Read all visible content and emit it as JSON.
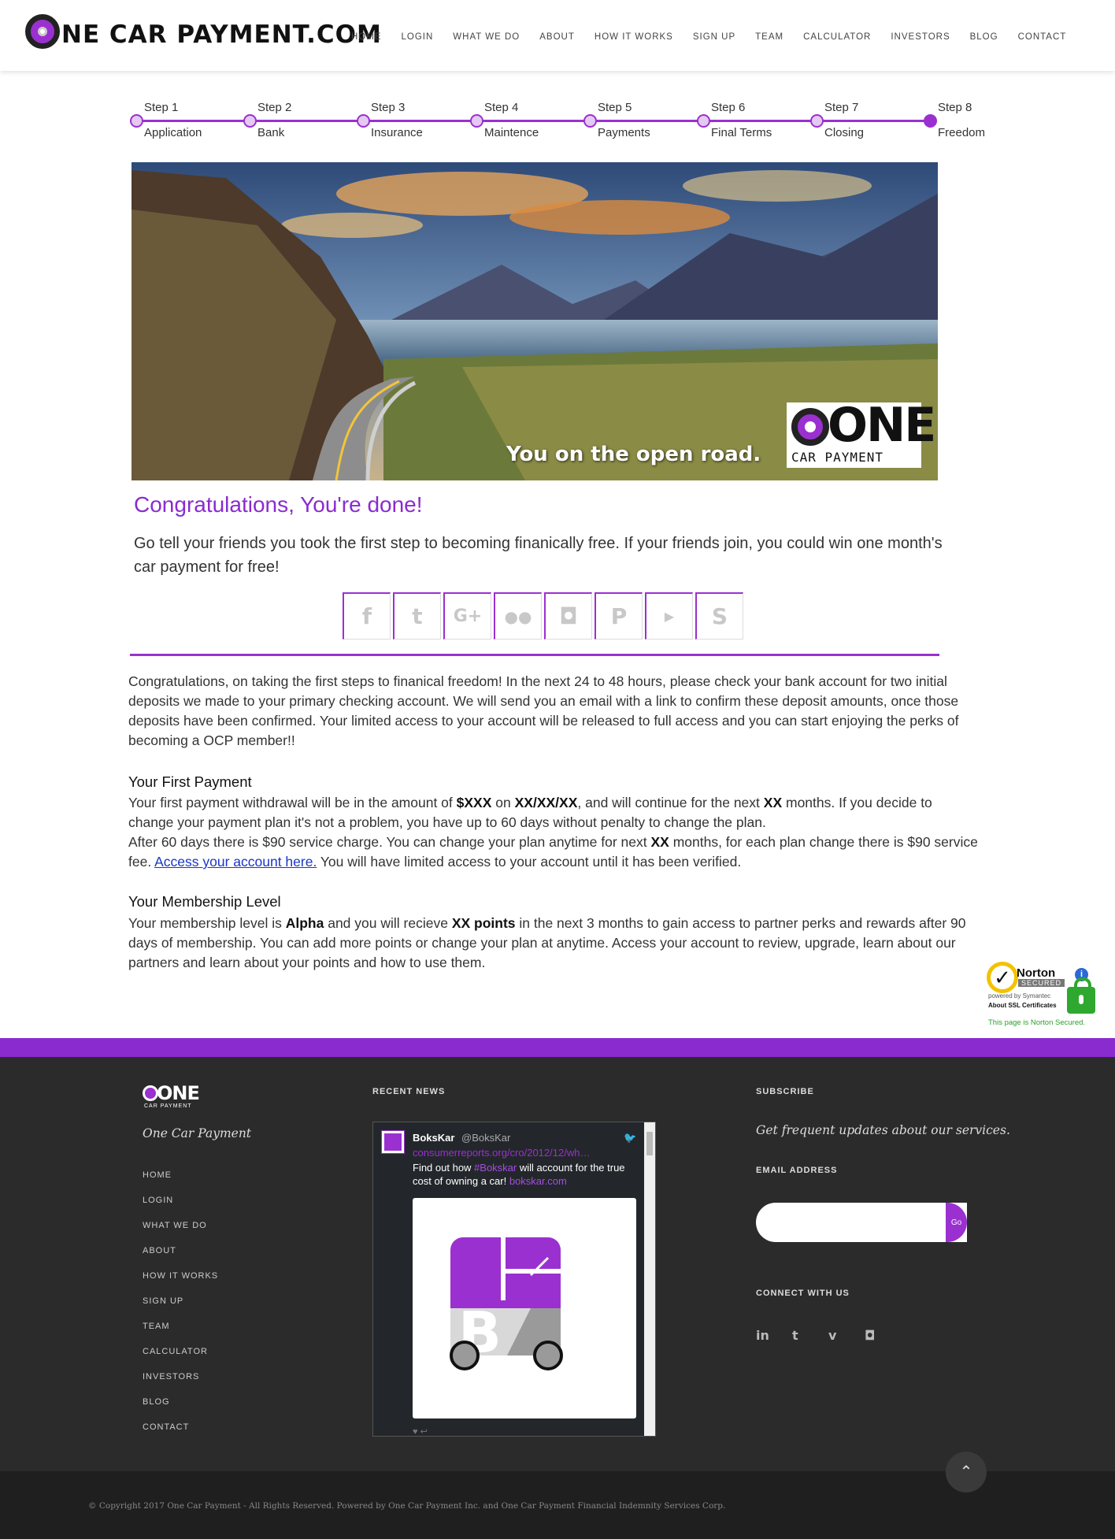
{
  "header": {
    "logo_text": "NE CAR PAYMENT.COM",
    "nav": [
      "HOME",
      "LOGIN",
      "WHAT WE DO",
      "ABOUT",
      "HOW IT WORKS",
      "SIGN UP",
      "TEAM",
      "CALCULATOR",
      "INVESTORS",
      "BLOG",
      "CONTACT"
    ]
  },
  "stepper": {
    "steps": [
      {
        "num": "Step 1",
        "name": "Application"
      },
      {
        "num": "Step 2",
        "name": "Bank"
      },
      {
        "num": "Step 3",
        "name": "Insurance"
      },
      {
        "num": "Step 4",
        "name": "Maintence"
      },
      {
        "num": "Step 5",
        "name": "Payments"
      },
      {
        "num": "Step 6",
        "name": "Final Terms"
      },
      {
        "num": "Step 7",
        "name": "Closing"
      },
      {
        "num": "Step 8",
        "name": "Freedom"
      }
    ],
    "active_step": 8
  },
  "hero": {
    "caption": "You on the open road.",
    "logo_one": "ONE",
    "logo_sub": "CAR PAYMENT"
  },
  "congrats": {
    "title": "Congratulations, You're done!",
    "subtitle": "Go tell your friends you took the first step to becoming finanically free.  If your friends join, you could win one month's car payment for free!"
  },
  "social": [
    "facebook-icon",
    "twitter-icon",
    "google-plus-icon",
    "flickr-icon",
    "instagram-icon",
    "pinterest-icon",
    "youtube-icon",
    "skype-icon"
  ],
  "intro": "Congratulations, on taking the first steps to finanical freedom!  In the next 24 to 48 hours, please check your bank account for two initial deposits we made to your primary checking account.  We will send you an email with a link to confirm these deposit amounts, once those deposits have been confirmed.  Your limited access to your account will be released to full access and you can start enjoying the perks of becoming a OCP member!!",
  "first_payment": {
    "heading": "Your First Payment",
    "p1_a": "Your first payment withdrawal will be in the amount of ",
    "amount": "$XXX",
    "p1_b": " on ",
    "date": "XX/XX/XX",
    "p1_c": ", and will continue for the next ",
    "months": "XX",
    "p1_d": " months.  If you decide to change your payment plan it's not a problem, you have up to 60 days without penalty to change the plan.",
    "p2_a": "After 60 days there is $90 service charge.  You can change your plan anytime for next ",
    "months2": "XX",
    "p2_b": " months, for each plan change there is $90 service fee.  ",
    "link": "Access your account here.",
    "p2_c": "  You will have limited access to your account until it has been verified."
  },
  "membership": {
    "heading": "Your Membership Level",
    "a": "Your membership level is ",
    "level": "Alpha",
    "b": " and you will recieve ",
    "points": "XX points",
    "c": " in the next 3 months to gain access to partner perks and rewards after 90 days of membership.  You can add more points or change your plan at anytime.  Access your account to review, upgrade, learn about our partners and learn about your points and how to use them."
  },
  "norton": {
    "name": "Norton",
    "secured": "SECURED",
    "powered": "powered by Symantec",
    "ssl": "About SSL Certificates",
    "foot": "This page is Norton Secured."
  },
  "footer": {
    "logo_one": "ONE",
    "logo_sub": "CAR PAYMENT",
    "brand": "One Car Payment",
    "nav": [
      "HOME",
      "LOGIN",
      "WHAT WE DO",
      "ABOUT",
      "HOW IT WORKS",
      "SIGN UP",
      "TEAM",
      "CALCULATOR",
      "INVESTORS",
      "BLOG",
      "CONTACT"
    ],
    "recent_news": "RECENT NEWS",
    "subscribe": "SUBSCRIBE",
    "subscribe_tag": "Get frequent updates about our services.",
    "email_label": "EMAIL ADDRESS",
    "email_placeholder": "",
    "go": "Go",
    "connect": "CONNECT WITH US",
    "connect_icons": [
      "linkedin-icon",
      "twitter-icon",
      "vimeo-icon",
      "instagram-icon"
    ],
    "copyright": "© Copyright 2017 One Car Payment - All Rights Reserved. Powered by One Car Payment Inc. and One Car Payment Financial Indemnity Services Corp."
  },
  "tweet": {
    "name": "BoksKar",
    "handle": "@BoksKar",
    "link": "consumerreports.org/cro/2012/12/wh…",
    "text_a": "Find out how ",
    "hashtag": "#Bokskar",
    "text_b": " will account for the true cost of owning a car! ",
    "site": "bokskar.com"
  }
}
